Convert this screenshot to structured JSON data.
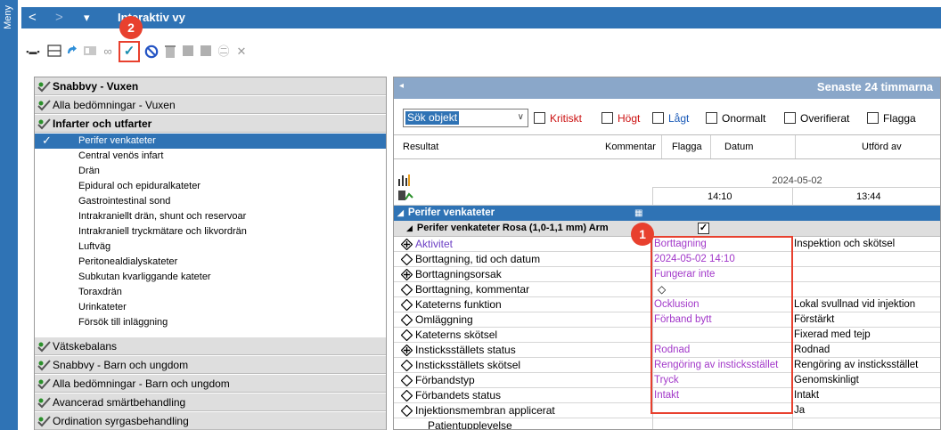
{
  "window": {
    "menu_label": "Meny",
    "title": "Interaktiv vy",
    "nav": {
      "back": "<",
      "forward": ">",
      "dropdown": "▾"
    }
  },
  "annotations": {
    "badge_1": "1",
    "badge_2": "2"
  },
  "toolbar": {
    "icons": [
      "bars-icon",
      "layout-icon",
      "refresh-icon",
      "card-icon",
      "binoculars-icon",
      "sign-check-icon",
      "block-icon",
      "bin-icon",
      "square-icon",
      "square2-icon",
      "text-icon",
      "close-icon"
    ],
    "sign_check_glyph": "✓",
    "close_glyph": "✕"
  },
  "left_panel": {
    "groups_top": [
      {
        "label": "Snabbvy - Vuxen",
        "bold": true
      },
      {
        "label": "Alla bedömningar - Vuxen",
        "bold": false
      },
      {
        "label": "Infarter och utfarter",
        "bold": true
      }
    ],
    "items": [
      "Perifer venkateter",
      "Central venös infart",
      "Drän",
      "Epidural och epiduralkateter",
      "Gastrointestinal sond",
      "Intrakraniellt drän, shunt och reservoar",
      "Intrakraniell tryckmätare och likvordrän",
      "Luftväg",
      "Peritonealdialyskateter",
      "Subkutan kvarliggande kateter",
      "Toraxdrän",
      "Urinkateter",
      "Försök till inläggning"
    ],
    "selected_index": 0,
    "groups_bottom": [
      "Vätskebalans",
      "Snabbvy - Barn och ungdom",
      "Alla bedömningar - Barn och ungdom",
      "Avancerad smärtbehandling",
      "Ordination syrgasbehandling"
    ]
  },
  "right_panel": {
    "header": "Senaste 24 timmarna",
    "search_combo": "Sök objekt",
    "filters": [
      {
        "label": "Kritiskt",
        "color": "#cc1111"
      },
      {
        "label": "Högt",
        "color": "#cc1111"
      },
      {
        "label": "Lågt",
        "color": "#1a5ab8"
      },
      {
        "label": "Onormalt",
        "color": "#000000"
      },
      {
        "label": "Overifierat",
        "color": "#000000"
      },
      {
        "label": "Flagga",
        "color": "#000000"
      }
    ],
    "columns": [
      "Resultat",
      "Kommentar",
      "Flagga",
      "Datum",
      "Utförd av"
    ],
    "date": "2024-05-02",
    "times": [
      "14:10",
      "13:44"
    ],
    "category": "Perifer venkateter",
    "subcategory": "Perifer venkateter Rosa (1,0-1,1 mm) Arm",
    "subcategory_checked": "✓",
    "rows": [
      {
        "label": "Aktivitet",
        "icon": "diamond-plus-icon",
        "link": true,
        "v1": "Borttagning",
        "v2": "Inspektion och skötsel"
      },
      {
        "label": "Borttagning, tid och datum",
        "icon": "diamond-icon",
        "link": false,
        "v1": "2024-05-02 14:10",
        "v2": ""
      },
      {
        "label": "Borttagningsorsak",
        "icon": "diamond-plus-icon",
        "link": false,
        "v1": "Fungerar inte",
        "v2": ""
      },
      {
        "label": "Borttagning, kommentar",
        "icon": "diamond-icon",
        "link": false,
        "v1": "◇",
        "v2": ""
      },
      {
        "label": "Kateterns funktion",
        "icon": "diamond-icon",
        "link": false,
        "v1": "Ocklusion",
        "v2": "Lokal svullnad vid injektion"
      },
      {
        "label": "Omläggning",
        "icon": "diamond-icon",
        "link": false,
        "v1": "Förband bytt",
        "v2": "Förstärkt"
      },
      {
        "label": "Kateterns skötsel",
        "icon": "diamond-icon",
        "link": false,
        "v1": "",
        "v2": "Fixerad med tejp"
      },
      {
        "label": "Insticksställets status",
        "icon": "diamond-plus-icon",
        "link": false,
        "v1": "Rodnad",
        "v2": "Rodnad"
      },
      {
        "label": "Insticksställets skötsel",
        "icon": "diamond-icon",
        "link": false,
        "v1": "Rengöring av insticksstället",
        "v2": "Rengöring av insticksstället"
      },
      {
        "label": "Förbandstyp",
        "icon": "diamond-icon",
        "link": false,
        "v1": "Tryck",
        "v2": "Genomskinligt"
      },
      {
        "label": "Förbandets status",
        "icon": "diamond-icon",
        "link": false,
        "v1": "Intakt",
        "v2": "Intakt"
      },
      {
        "label": "Injektionsmembran applicerat",
        "icon": "diamond-icon",
        "link": false,
        "v1": "",
        "v2": "Ja"
      },
      {
        "label": "Patientupplevelse",
        "icon": "",
        "link": false,
        "v1": "",
        "v2": ""
      }
    ]
  }
}
